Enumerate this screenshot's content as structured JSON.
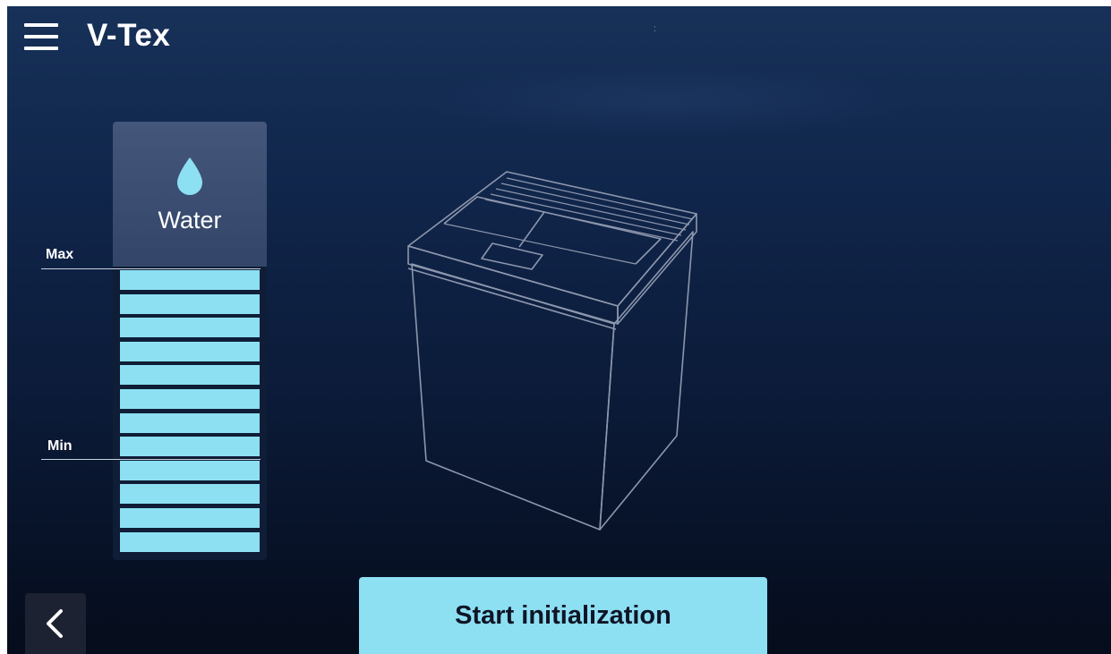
{
  "header": {
    "menu_icon": "hamburger-menu-icon",
    "title": "V-Tex",
    "status_mark": ":"
  },
  "water_tank": {
    "label": "Water",
    "icon": "water-drop-icon",
    "max_label": "Max",
    "min_label": "Min",
    "total_segments": 12,
    "filled_segments": 12
  },
  "actions": {
    "back_icon": "chevron-left-icon",
    "start_label": "Start initialization"
  },
  "colors": {
    "accent": "#8ddff2",
    "background_top": "#173158",
    "background_bottom": "#050c1b"
  }
}
